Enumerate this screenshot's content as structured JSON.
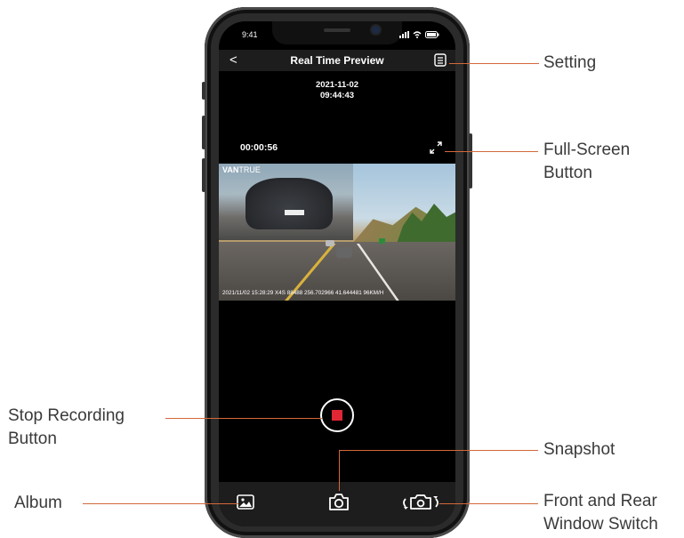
{
  "status_bar": {
    "time": "9:41"
  },
  "header": {
    "back": "<",
    "title": "Real Time Preview"
  },
  "preview": {
    "date": "2021-11-02",
    "time": "09:44:43",
    "rec_timer": "00:00:56",
    "brand_bold": "VAN",
    "brand_light": "TRUE",
    "overlay": "2021/11/02 15:28:29 X4S 88488   256.702966  41.644481 96KM/H"
  },
  "callouts": {
    "setting": "Setting",
    "fullscreen_1": "Full-Screen",
    "fullscreen_2": "Button",
    "stop_1": "Stop Recording",
    "stop_2": "Button",
    "snapshot": "Snapshot",
    "album": "Album",
    "switch_1": "Front and Rear",
    "switch_2": "Window Switch"
  },
  "icons": {
    "setting": "document-icon",
    "fullscreen": "expand-icon",
    "record": "stop-record-icon",
    "album": "image-icon",
    "snapshot": "camera-icon",
    "switch": "camera-switch-icon"
  },
  "colors": {
    "accent": "#d4693a",
    "record_red": "#e12636",
    "bar_bg": "#1d1d1d"
  }
}
